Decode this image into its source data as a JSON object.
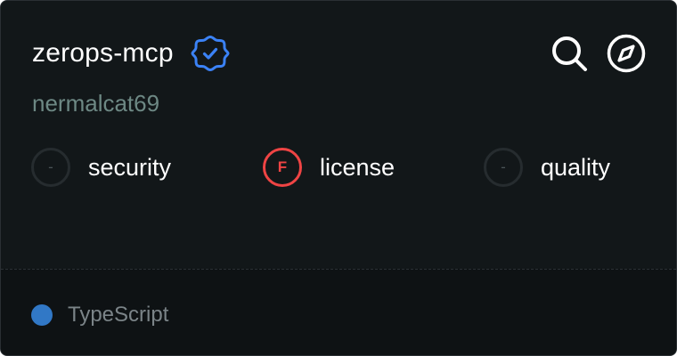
{
  "repo": {
    "name": "zerops-mcp",
    "author": "nermalcat69",
    "verified_icon": "verified-badge-icon"
  },
  "actions": [
    {
      "icon": "search-icon"
    },
    {
      "icon": "compass-icon"
    }
  ],
  "scores": [
    {
      "grade": "-",
      "label": "security",
      "status": "neutral"
    },
    {
      "grade": "F",
      "label": "license",
      "status": "fail"
    },
    {
      "grade": "-",
      "label": "quality",
      "status": "neutral"
    }
  ],
  "footer": {
    "language": "TypeScript",
    "language_color": "#3178c6"
  },
  "colors": {
    "background": "#121719",
    "accent_verified": "#3b82f6",
    "fail": "#ef4444",
    "author": "#6d8884"
  }
}
